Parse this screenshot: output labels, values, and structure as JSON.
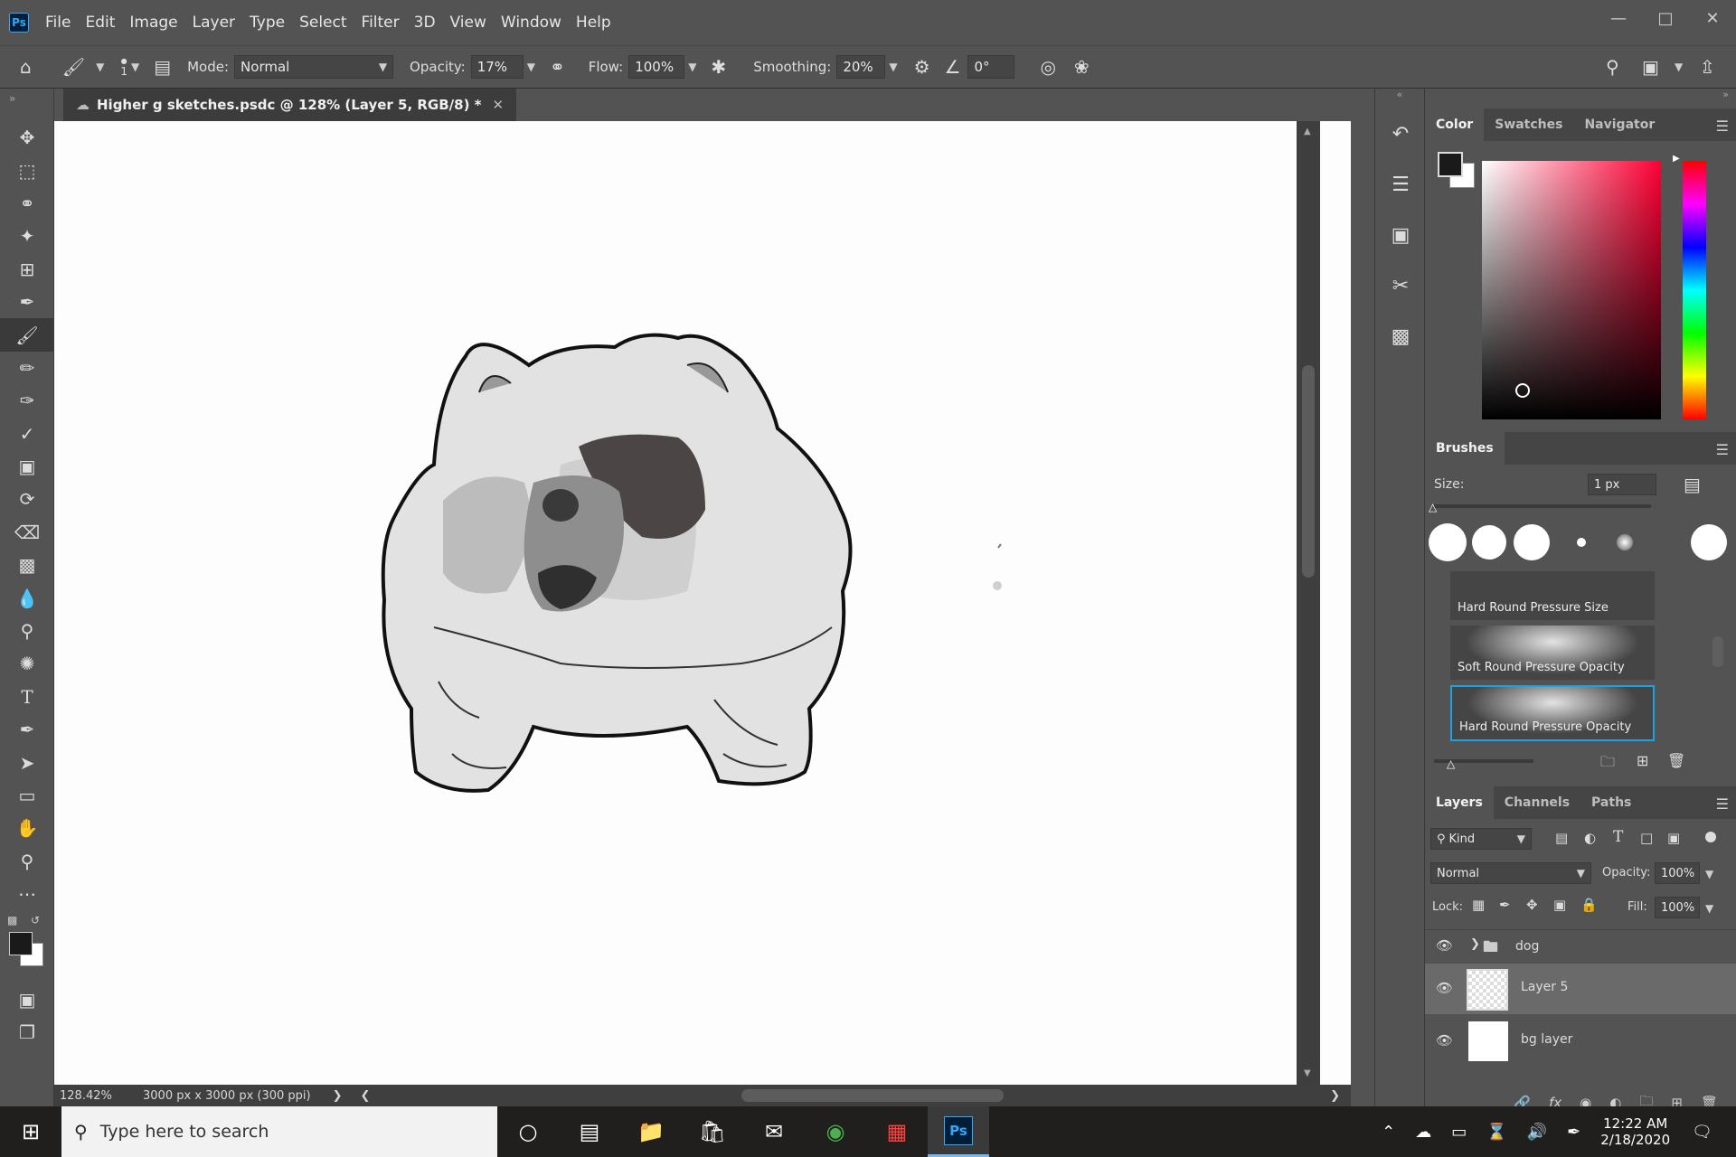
{
  "app": {
    "logo": "Ps"
  },
  "menu": [
    "File",
    "Edit",
    "Image",
    "Layer",
    "Type",
    "Select",
    "Filter",
    "3D",
    "View",
    "Window",
    "Help"
  ],
  "options": {
    "brush_size_small": "1",
    "mode_label": "Mode:",
    "mode_value": "Normal",
    "opacity_label": "Opacity:",
    "opacity_value": "17%",
    "flow_label": "Flow:",
    "flow_value": "100%",
    "smoothing_label": "Smoothing:",
    "smoothing_value": "20%",
    "angle_value": "0°"
  },
  "document": {
    "tab_title": "Higher g sketches.psdc @ 128% (Layer 5, RGB/8) *",
    "zoom": "128.42%",
    "dimensions": "3000 px x 3000 px (300 ppi)"
  },
  "color_panel": {
    "tabs": [
      "Color",
      "Swatches",
      "Navigator"
    ],
    "active": "Color",
    "base_hue": "#ff0033"
  },
  "brushes_panel": {
    "tab": "Brushes",
    "size_label": "Size:",
    "size_value": "1 px",
    "presets": [
      "Hard Round Pressure Size",
      "Soft Round Pressure Opacity",
      "Hard Round Pressure Opacity"
    ],
    "selected": "Hard Round Pressure Opacity"
  },
  "layers_panel": {
    "tabs": [
      "Layers",
      "Channels",
      "Paths"
    ],
    "kind_label": "Kind",
    "blend_mode": "Normal",
    "opacity_label": "Opacity:",
    "opacity_value": "100%",
    "lock_label": "Lock:",
    "fill_label": "Fill:",
    "fill_value": "100%",
    "layers": [
      {
        "name": "dog",
        "type": "group"
      },
      {
        "name": "Layer 5",
        "type": "layer",
        "selected": true
      },
      {
        "name": "bg layer",
        "type": "layer"
      }
    ]
  },
  "taskbar": {
    "search_placeholder": "Type here to search",
    "time": "12:22 AM",
    "date": "2/18/2020"
  }
}
